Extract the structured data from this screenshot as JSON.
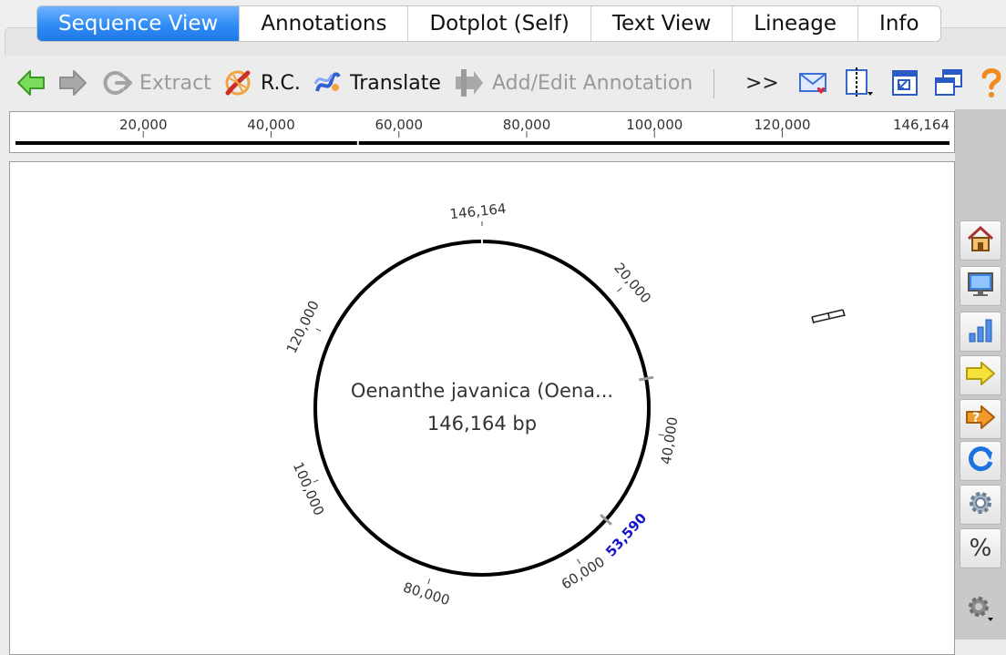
{
  "tabs": [
    "Sequence View",
    "Annotations",
    "Dotplot (Self)",
    "Text View",
    "Lineage",
    "Info"
  ],
  "active_tab": "Sequence View",
  "toolbar": {
    "back_icon": "arrow-left-green-icon",
    "forward_icon": "arrow-right-gray-icon",
    "extract": "Extract",
    "rc": "R.C.",
    "translate": "Translate",
    "add_annotation": "Add/Edit Annotation",
    "overflow": ">>"
  },
  "ruler": {
    "ticks": [
      "20,000",
      "40,000",
      "60,000",
      "80,000",
      "100,000",
      "120,000"
    ],
    "end_label": "146,164",
    "total": 146164,
    "selection": 53590
  },
  "map": {
    "name": "Oenanthe javanica (Oena...",
    "length_label": "146,164 bp",
    "top_label": "146,164",
    "tick_labels": [
      "20,000",
      "40,000",
      "60,000",
      "80,000",
      "100,000",
      "120,000"
    ],
    "cursor_label": "53,590",
    "cursor_color": "#1414c8"
  },
  "right_panel_icons": [
    "home-icon",
    "monitor-icon",
    "bar-chart-icon",
    "arrow-right-yellow-icon",
    "help-arrow-icon",
    "refresh-icon",
    "gear-icon",
    "percent-icon",
    "settings-dropdown-icon"
  ],
  "percent_label": "%"
}
